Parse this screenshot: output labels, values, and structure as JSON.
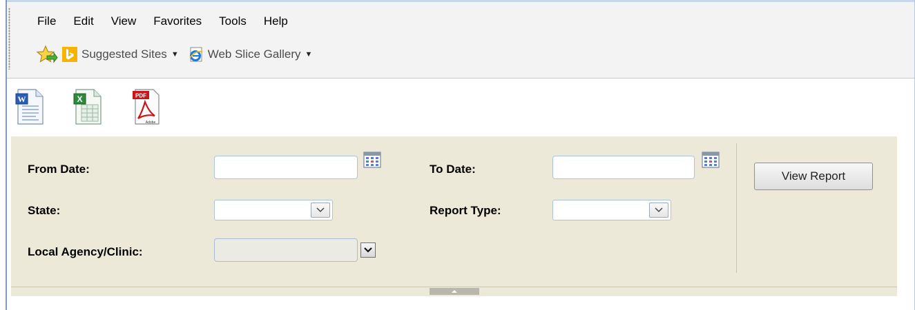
{
  "menu": {
    "items": [
      "File",
      "Edit",
      "View",
      "Favorites",
      "Tools",
      "Help"
    ]
  },
  "favorites": {
    "suggested_sites": "Suggested Sites",
    "web_slice_gallery": "Web Slice Gallery"
  },
  "exports": {
    "icons": [
      "word-export-icon",
      "excel-export-icon",
      "pdf-export-icon"
    ],
    "pdf_badge": "PDF",
    "adobe_label": "Adobe"
  },
  "parameters": {
    "from_date_label": "From Date:",
    "from_date_value": "",
    "to_date_label": "To Date:",
    "to_date_value": "",
    "state_label": "State:",
    "state_value": "",
    "report_type_label": "Report Type:",
    "report_type_value": "",
    "local_agency_label": "Local Agency/Clinic:",
    "local_agency_value": "",
    "view_report_label": "View Report"
  },
  "colors": {
    "panel_bg": "#ece9d8",
    "chrome_bg": "#f3f3f3",
    "input_border": "#a9c3e0",
    "bing_orange": "#f4b400"
  }
}
